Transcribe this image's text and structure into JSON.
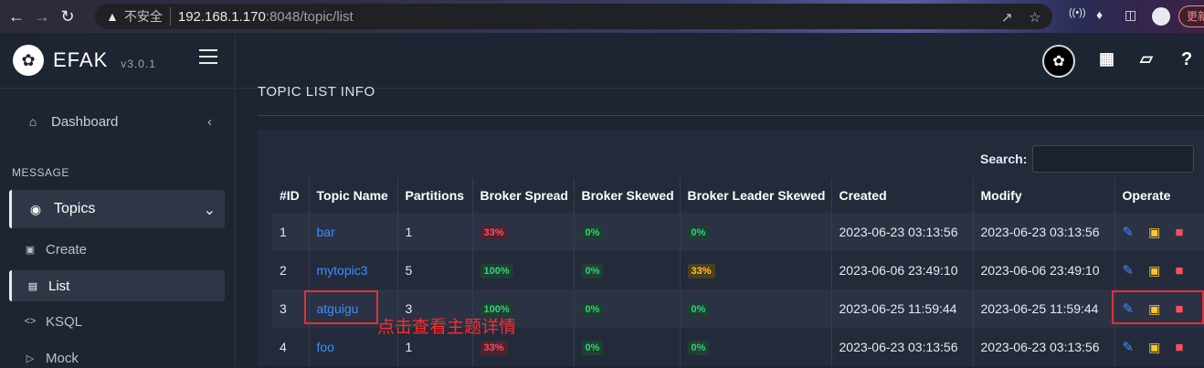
{
  "browser": {
    "insecure_label": "不安全",
    "url_host": "192.168.1.170",
    "url_rest": ":8048/topic/list",
    "update_label": "更新"
  },
  "sidebar": {
    "brand": "EFAK",
    "version": "v3.0.1",
    "dashboard": "Dashboard",
    "section_label": "MESSAGE",
    "topics": "Topics",
    "subitems": [
      "Create",
      "List",
      "KSQL",
      "Mock"
    ]
  },
  "page": {
    "title": "TOPIC LIST INFO",
    "search_label": "Search:",
    "search_value": ""
  },
  "table": {
    "headers": [
      "#ID",
      "Topic Name",
      "Partitions",
      "Broker Spread",
      "Broker Skewed",
      "Broker Leader Skewed",
      "Created",
      "Modify",
      "Operate"
    ],
    "rows": [
      {
        "id": "1",
        "name": "bar",
        "partitions": "1",
        "spread": "33%",
        "skewed": "0%",
        "leader": "0%",
        "created": "2023-06-23 03:13:56",
        "modify": "2023-06-23 03:13:56"
      },
      {
        "id": "2",
        "name": "mytopic3",
        "partitions": "5",
        "spread": "100%",
        "skewed": "0%",
        "leader": "33%",
        "created": "2023-06-06 23:49:10",
        "modify": "2023-06-06 23:49:10"
      },
      {
        "id": "3",
        "name": "atguigu",
        "partitions": "3",
        "spread": "100%",
        "skewed": "0%",
        "leader": "0%",
        "created": "2023-06-25 11:59:44",
        "modify": "2023-06-25 11:59:44"
      },
      {
        "id": "4",
        "name": "foo",
        "partitions": "1",
        "spread": "33%",
        "skewed": "0%",
        "leader": "0%",
        "created": "2023-06-23 03:13:56",
        "modify": "2023-06-23 03:13:56"
      }
    ]
  },
  "annotation": "点击查看主题详情",
  "colors": {
    "link": "#3f8cff",
    "badge_red": "#ff4d5e",
    "badge_green": "#34d27a",
    "badge_yellow": "#ffc530",
    "annotation": "#ff2a2a"
  }
}
